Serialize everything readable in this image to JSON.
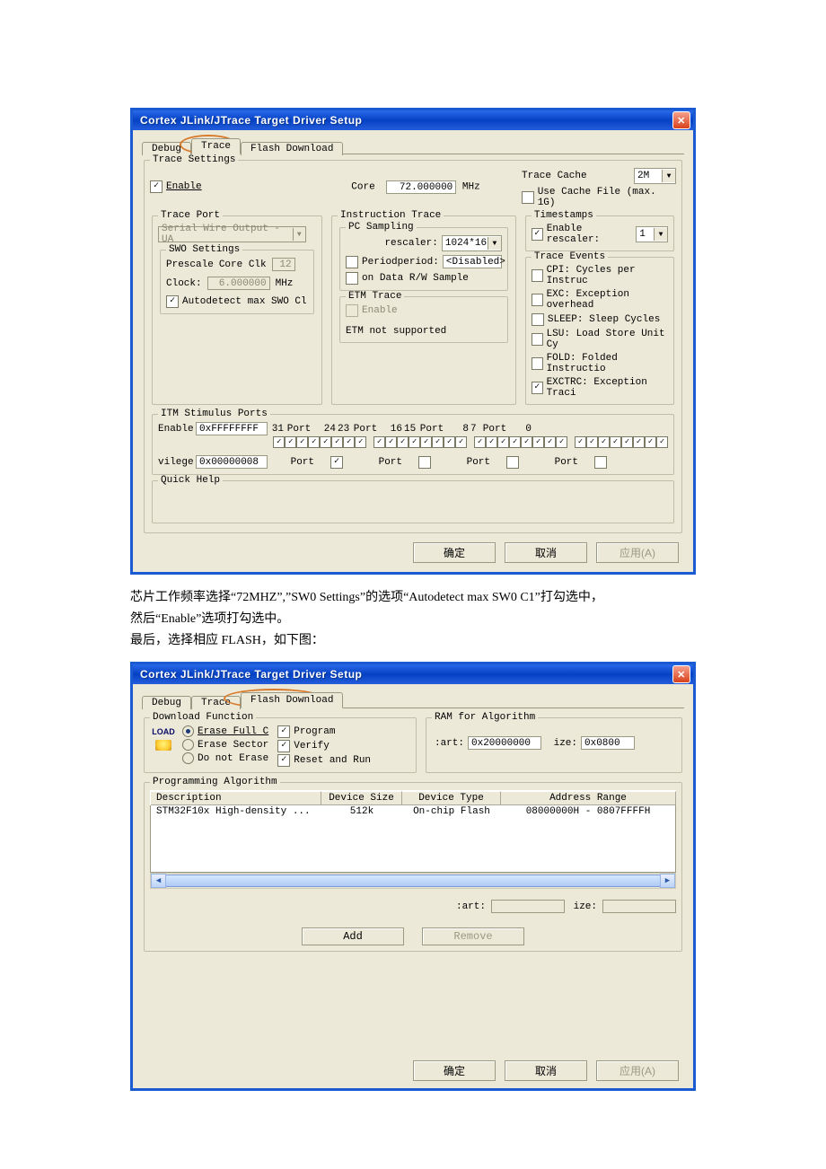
{
  "dialog1": {
    "title": "Cortex JLink/JTrace Target Driver Setup",
    "tabs": [
      "Debug",
      "Trace",
      "Flash Download"
    ],
    "active_tab": 1,
    "trace_settings": {
      "legend": "Trace Settings",
      "enable": {
        "label": "Enable",
        "checked": true
      },
      "core_label": "Core",
      "core_value": "72.000000",
      "core_unit": "MHz",
      "trace_cache_label": "Trace Cache",
      "trace_cache_value": "2M",
      "use_cache_file": {
        "label": "Use Cache File (max. 1G)",
        "checked": false
      },
      "trace_port": {
        "legend": "Trace Port",
        "port_value": "Serial Wire Output - UA",
        "swo": {
          "legend": "SWO Settings",
          "prescale_label": "Prescale",
          "core_clk_label": "Core Clk",
          "core_clk_value": "12",
          "clock_label": "Clock:",
          "clock_value": "6.000000",
          "clock_unit": "MHz",
          "autodetect": {
            "label": "Autodetect max SWO Cl",
            "checked": true
          }
        }
      },
      "instruction_trace": {
        "legend": "Instruction Trace",
        "pc_sampling": {
          "legend": "PC Sampling",
          "rescaler_label": "rescaler:",
          "rescaler_value": "1024*16",
          "period": {
            "label": "Periodperiod:",
            "value": "<Disabled>",
            "checked": false
          },
          "on_data": {
            "label": "on Data R/W Sample",
            "checked": false
          }
        },
        "etm": {
          "legend": "ETM Trace",
          "enable": {
            "label": "Enable",
            "checked": false
          },
          "note": "ETM not supported"
        }
      },
      "timestamps": {
        "legend": "Timestamps",
        "enable_rescaler": {
          "label": "Enable rescaler:",
          "checked": true,
          "value": "1"
        }
      },
      "trace_events": {
        "legend": "Trace Events",
        "items": [
          {
            "label": "CPI: Cycles per Instruc",
            "checked": false
          },
          {
            "label": "EXC: Exception overhead",
            "checked": false
          },
          {
            "label": "SLEEP: Sleep Cycles",
            "checked": false
          },
          {
            "label": "LSU: Load Store Unit Cy",
            "checked": false
          },
          {
            "label": "FOLD: Folded Instructio",
            "checked": false
          },
          {
            "label": "EXCTRC: Exception Traci",
            "checked": true
          }
        ]
      },
      "itm": {
        "legend": "ITM Stimulus Ports",
        "enable_label": "Enable:",
        "enable_value": "0xFFFFFFFF",
        "vilege_label": "vilege:",
        "vilege_value": "0x00000008",
        "bit_31": "31",
        "port_label": "Port",
        "bit_24": "24",
        "bit_23": "23",
        "bit_16": "16",
        "bit_15": "15",
        "bit_8": "8",
        "bit_7": "7",
        "bit_0": "0",
        "priv_port1_checked": true,
        "priv_port2_checked": false,
        "priv_port3_checked": false,
        "priv_port4_checked": false
      },
      "quick_help": {
        "legend": "Quick Help"
      }
    },
    "buttons": {
      "ok": "确定",
      "cancel": "取消",
      "apply": "应用(A)"
    }
  },
  "annotation": {
    "line1": "芯片工作频率选择“72MHZ”,”SW0 Settings”的选项“Autodetect max SW0 C1”打勾选中，",
    "line2": "然后“Enable”选项打勾选中。",
    "line3": "最后，选择相应 FLASH，如下图："
  },
  "dialog2": {
    "title": "Cortex JLink/JTrace Target Driver Setup",
    "tabs": [
      "Debug",
      "Trace",
      "Flash Download"
    ],
    "active_tab": 2,
    "download": {
      "legend": "Download Function",
      "icon_text": "LOAD",
      "radios": [
        {
          "label": "Erase Full C",
          "selected": true
        },
        {
          "label": "Erase Sector",
          "selected": false
        },
        {
          "label": "Do not Erase",
          "selected": false
        }
      ],
      "checks": [
        {
          "label": "Program",
          "checked": true
        },
        {
          "label": "Verify",
          "checked": true
        },
        {
          "label": "Reset and Run",
          "checked": true
        }
      ]
    },
    "ram": {
      "legend": "RAM for Algorithm",
      "start_label": ":art:",
      "start_value": "0x20000000",
      "size_label": "ize:",
      "size_value": "0x0800"
    },
    "prog": {
      "legend": "Programming Algorithm",
      "headers": [
        "Description",
        "Device Size",
        "Device Type",
        "Address Range"
      ],
      "rows": [
        {
          "desc": "STM32F10x High-density ...",
          "size": "512k",
          "type": "On-chip Flash",
          "range": "08000000H - 0807FFFFH"
        }
      ],
      "start_label": ":art:",
      "size_label": "ize:",
      "add": "Add",
      "remove": "Remove"
    },
    "buttons": {
      "ok": "确定",
      "cancel": "取消",
      "apply": "应用(A)"
    }
  }
}
